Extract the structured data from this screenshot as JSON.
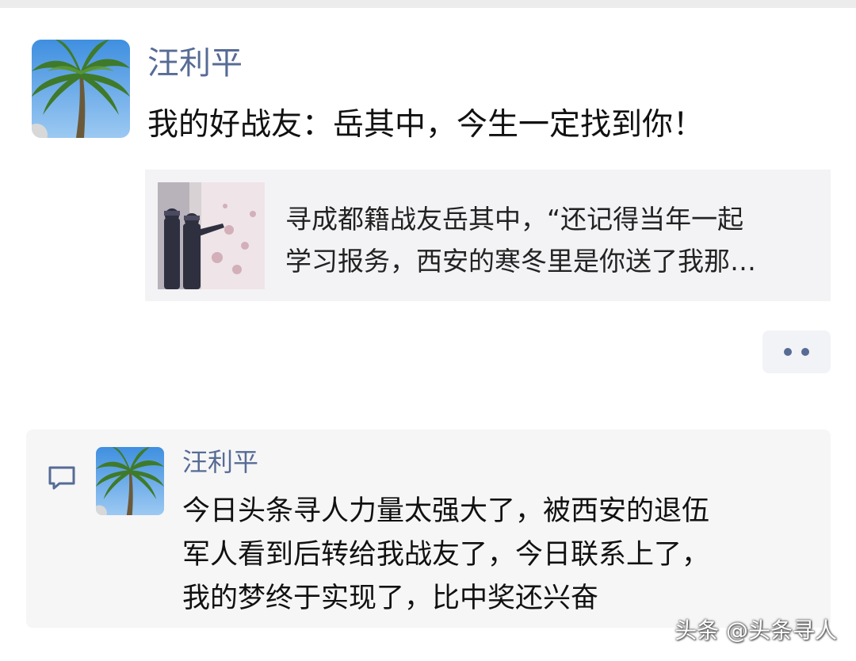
{
  "post": {
    "author": "汪利平",
    "text": "我的好战友：岳其中，今生一定找到你！",
    "link_card": {
      "lines": [
        "寻成都籍战友岳其中，“还记得当年一起",
        "学习报务，西安的寒冬里是你送了我那…"
      ]
    },
    "more_icon": "more-dots-icon"
  },
  "comment": {
    "icon": "comment-icon",
    "author": "汪利平",
    "lines": [
      "今日头条寻人力量太强大了，被西安的退伍",
      "军人看到后转给我战友了，今日联系上了，",
      "我的梦终于实现了，比中奖还兴奋"
    ]
  },
  "watermark": "头条 @头条寻人",
  "colors": {
    "name_link": "#576b95",
    "card_bg": "#f3f3f5",
    "comment_bg": "#f6f6f7"
  }
}
